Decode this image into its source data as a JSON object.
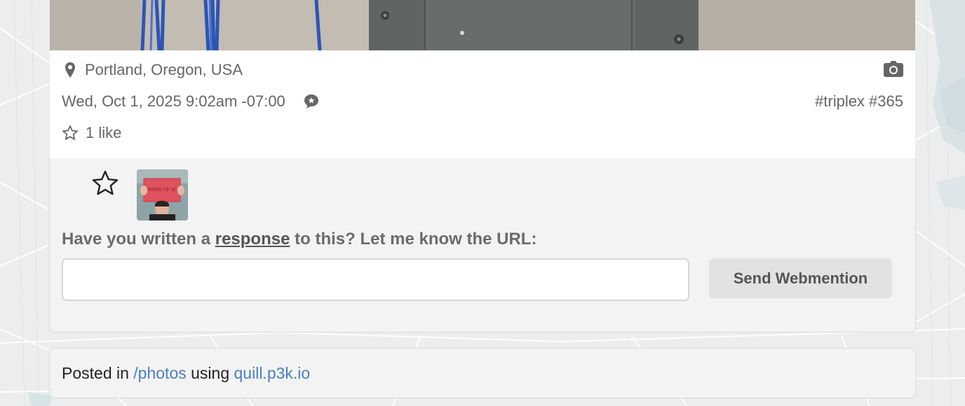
{
  "post": {
    "location": "Portland, Oregon, USA",
    "date": "Wed, Oct 1, 2025 9:02am -07:00",
    "tags": "#triplex #365",
    "likes": "1 like"
  },
  "interactions": {
    "prompt_before": "Have you written a",
    "prompt_link": "response",
    "prompt_after": "to this? Let me know the URL:",
    "input_value": "",
    "send_label": "Send Webmention",
    "avatar_sign_text": "WEEK OF 3E"
  },
  "footer": {
    "posted_in": "Posted in",
    "channel_link": "/photos",
    "using": "using",
    "client_link": "quill.p3k.io"
  },
  "icons": {
    "location": "map-pin-icon",
    "camera": "camera-icon",
    "reply": "reply-bubble-icon",
    "like": "star-icon"
  },
  "colors": {
    "link": "#4a7fbf",
    "meta_text": "#666666",
    "button_bg": "#e1e2e4"
  }
}
